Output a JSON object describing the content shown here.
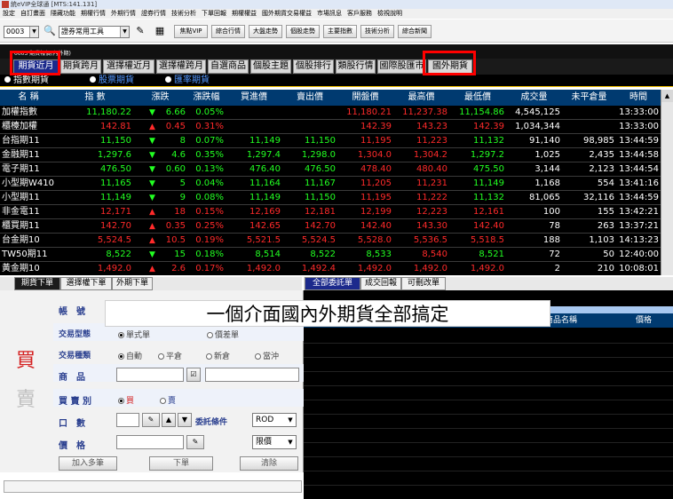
{
  "window": {
    "title": "統eVIP全球通 [MTS:141.131]"
  },
  "menu": [
    "設定",
    "自訂畫面",
    "隱藏功能",
    "期權行情",
    "外期行情",
    "證券行情",
    "技術分析",
    "下單回報",
    "期權權益",
    "國外期貨交易權益",
    "市場訊息",
    "客戶服務",
    "檢視說明"
  ],
  "toolbar": {
    "account": "0003",
    "tools_select": "證券常用工具",
    "buttons": [
      "焦點VIP",
      "綜合行情",
      "大盤走勢",
      "個股走勢",
      "主要指數",
      "技術分析",
      "綜合新聞"
    ]
  },
  "sub_label": "0003 期貨報價(內外期)",
  "tabs": [
    "期貨近月",
    "期貨跨月",
    "選擇權近月",
    "選擇權跨月",
    "自選商品",
    "個股主題",
    "個股排行",
    "類股行情",
    "國際股匯市",
    "國外期貨"
  ],
  "radios": [
    {
      "label": "指數期貨",
      "selected": true
    },
    {
      "label": "股票期貨",
      "selected": false
    },
    {
      "label": "匯率期貨",
      "selected": false
    }
  ],
  "columns": [
    "名 稱",
    "指 數",
    "漲跌",
    "漲跌幅",
    "買進價",
    "賣出價",
    "開盤價",
    "最高價",
    "最低價",
    "成交量",
    "未平倉量",
    "時間"
  ],
  "colors": {
    "up": "#ff2a2a",
    "down": "#22ff22",
    "flat": "#ffffff",
    "name": "#ffffff",
    "bid_ask": "#22ff22"
  },
  "rows": [
    {
      "name": "加權指數",
      "price": "11,180.22",
      "dir": "down",
      "change": "6.66",
      "pct": "0.05%",
      "bid": "",
      "ask": "",
      "open": "11,180.21",
      "high": "11,237.38",
      "low": "11,154.86",
      "vol": "4,545,125",
      "oi": "",
      "time": "13:33:00",
      "pc": "down",
      "oc": "up",
      "hc": "up",
      "lc": "down"
    },
    {
      "name": "櫃檯加權",
      "price": "142.81",
      "dir": "up",
      "change": "0.45",
      "pct": "0.31%",
      "bid": "",
      "ask": "",
      "open": "142.39",
      "high": "143.23",
      "low": "142.39",
      "vol": "1,034,344",
      "oi": "",
      "time": "13:33:00",
      "pc": "up",
      "oc": "up",
      "hc": "up",
      "lc": "up"
    },
    {
      "name": "台指期11",
      "price": "11,150",
      "dir": "down",
      "change": "8",
      "pct": "0.07%",
      "bid": "11,149",
      "ask": "11,150",
      "open": "11,195",
      "high": "11,223",
      "low": "11,132",
      "vol": "91,140",
      "oi": "98,985",
      "time": "13:44:59",
      "pc": "down",
      "oc": "up",
      "hc": "up",
      "lc": "down"
    },
    {
      "name": "金融期11",
      "price": "1,297.6",
      "dir": "down",
      "change": "4.6",
      "pct": "0.35%",
      "bid": "1,297.4",
      "ask": "1,298.0",
      "open": "1,304.0",
      "high": "1,304.2",
      "low": "1,297.2",
      "vol": "1,025",
      "oi": "2,435",
      "time": "13:44:58",
      "pc": "down",
      "oc": "up",
      "hc": "up",
      "lc": "down"
    },
    {
      "name": "電子期11",
      "price": "476.50",
      "dir": "down",
      "change": "0.60",
      "pct": "0.13%",
      "bid": "476.40",
      "ask": "476.50",
      "open": "478.40",
      "high": "480.40",
      "low": "475.50",
      "vol": "3,144",
      "oi": "2,123",
      "time": "13:44:54",
      "pc": "down",
      "oc": "up",
      "hc": "up",
      "lc": "down"
    },
    {
      "name": "小型期W410",
      "price": "11,165",
      "dir": "down",
      "change": "5",
      "pct": "0.04%",
      "bid": "11,164",
      "ask": "11,167",
      "open": "11,205",
      "high": "11,231",
      "low": "11,149",
      "vol": "1,168",
      "oi": "554",
      "time": "13:41:16",
      "pc": "down",
      "oc": "up",
      "hc": "up",
      "lc": "down"
    },
    {
      "name": "小型期11",
      "price": "11,149",
      "dir": "down",
      "change": "9",
      "pct": "0.08%",
      "bid": "11,149",
      "ask": "11,150",
      "open": "11,195",
      "high": "11,222",
      "low": "11,132",
      "vol": "81,065",
      "oi": "32,116",
      "time": "13:44:59",
      "pc": "down",
      "oc": "up",
      "hc": "up",
      "lc": "down"
    },
    {
      "name": "非金電11",
      "price": "12,171",
      "dir": "up",
      "change": "18",
      "pct": "0.15%",
      "bid": "12,169",
      "ask": "12,181",
      "open": "12,199",
      "high": "12,223",
      "low": "12,161",
      "vol": "100",
      "oi": "155",
      "time": "13:42:21",
      "pc": "up",
      "oc": "up",
      "hc": "up",
      "lc": "up"
    },
    {
      "name": "櫃買期11",
      "price": "142.70",
      "dir": "up",
      "change": "0.35",
      "pct": "0.25%",
      "bid": "142.65",
      "ask": "142.70",
      "open": "142.40",
      "high": "143.30",
      "low": "142.40",
      "vol": "78",
      "oi": "263",
      "time": "13:37:21",
      "pc": "up",
      "oc": "up",
      "hc": "up",
      "lc": "up"
    },
    {
      "name": "台金期10",
      "price": "5,524.5",
      "dir": "up",
      "change": "10.5",
      "pct": "0.19%",
      "bid": "5,521.5",
      "ask": "5,524.5",
      "open": "5,528.0",
      "high": "5,536.5",
      "low": "5,518.5",
      "vol": "188",
      "oi": "1,103",
      "time": "14:13:23",
      "pc": "up",
      "oc": "up",
      "hc": "up",
      "lc": "up"
    },
    {
      "name": "TW50期11",
      "price": "8,522",
      "dir": "down",
      "change": "15",
      "pct": "0.18%",
      "bid": "8,514",
      "ask": "8,522",
      "open": "8,533",
      "high": "8,540",
      "low": "8,521",
      "vol": "72",
      "oi": "50",
      "time": "12:40:00",
      "pc": "down",
      "oc": "down",
      "hc": "up",
      "lc": "down"
    },
    {
      "name": "黃金期10",
      "price": "1,492.0",
      "dir": "up",
      "change": "2.6",
      "pct": "0.17%",
      "bid": "1,492.0",
      "ask": "1,492.4",
      "open": "1,492.0",
      "high": "1,492.0",
      "low": "1,492.0",
      "vol": "2",
      "oi": "210",
      "time": "10:08:01",
      "pc": "up",
      "oc": "up",
      "hc": "up",
      "lc": "up"
    }
  ],
  "order_tabs": [
    "期貨下單",
    "選擇權下單",
    "外期下單"
  ],
  "report_tabs": [
    "全部委託單",
    "成交回報",
    "可刪改單"
  ],
  "order_form": {
    "buy_glyph": "買",
    "sell_glyph": "賣",
    "account_label": "帳　號",
    "order_type_label": "交易型態",
    "order_type_options": [
      "單式單",
      "價差單"
    ],
    "trade_type_label": "交易種類",
    "trade_type_options": [
      "自動",
      "平倉",
      "新倉",
      "當沖"
    ],
    "product_label": "商　品",
    "side_label": "買 賣 別",
    "side_options": [
      "買",
      "賣"
    ],
    "qty_label": "口　數",
    "cond_label": "委託條件",
    "cond_value": "ROD",
    "price_label": "價　格",
    "price_type": "限價",
    "add_multi": "加入多筆",
    "submit": "下單",
    "clear": "清除"
  },
  "report_columns": [
    "商品名稱",
    "價格"
  ],
  "overlay_text": "一個介面國內外期貨全部搞定"
}
